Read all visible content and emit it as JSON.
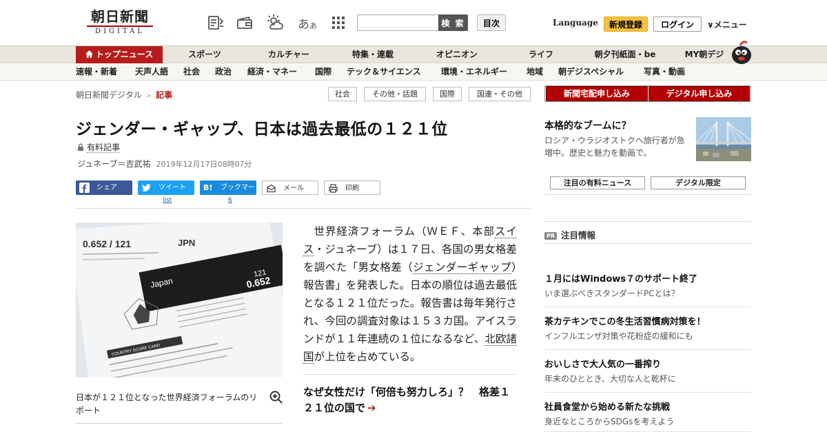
{
  "header": {
    "logo_main": "朝日新聞",
    "logo_sub": "DIGITAL",
    "font_size_main": "あ",
    "font_size_small": "あ",
    "search_placeholder": "",
    "search_button": "検 索",
    "index_button": "目次",
    "language": "Language",
    "register": "新規登録",
    "login": "ログイン",
    "menu": "メニュー",
    "icons": [
      "clip-icon",
      "wallet-icon",
      "weather-icon",
      "font-size-icon",
      "grid-icon"
    ]
  },
  "nav_primary": [
    "トップニュース",
    "スポーツ",
    "カルチャー",
    "特集・連載",
    "オピニオン",
    "ライフ",
    "朝夕刊紙面・be",
    "MY朝デジ"
  ],
  "nav_secondary": [
    "速報・新着",
    "天声人語",
    "社会",
    "政治",
    "経済・マネー",
    "国際",
    "テック＆サイエンス",
    "環境・エネルギー",
    "地域",
    "朝デジスペシャル",
    "写真・動画"
  ],
  "breadcrumb": {
    "home": "朝日新聞デジタル",
    "current": "記事"
  },
  "tags": [
    "社会",
    "その他・話題",
    "国際",
    "国連・その他"
  ],
  "article": {
    "title": "ジェンダー・ギャップ、日本は過去最低の１２１位",
    "paid_label": "有料記事",
    "byline": "ジュネーブ＝吉武祐",
    "date": "2019年12月17日08時07分",
    "body_parts": {
      "p1": "世界経済フォーラム（ＷＥＦ、本部",
      "l1": "スイス",
      "p2": "・ジュネーブ）は１７日、各国の男女格差を調べた「男女格差（",
      "l2": "ジェンダーギャップ",
      "p3": "）報告書」を発表した。日本の順位は過去最低となる１２１位だった。報告書は毎年発行され、今回の調査対象は１５３カ国。アイスランドが１１年連続の１位になるなど、",
      "l3": "北欧諸国",
      "p4": "が上位を占めている。"
    },
    "related": "なぜ女性だけ「何倍も努力しろ」？　格差１２１位の国で",
    "photo_caption": "日本が１２１位となった世界経済フォーラムのリポート",
    "photo_text": {
      "score_line": "0.652 / 121",
      "code": "JPN",
      "country": "Japan",
      "rank": "121",
      "score": "0.652",
      "section": "COUNTRY SCORE CARD"
    }
  },
  "share": {
    "facebook": "シェア",
    "twitter": "ツイート",
    "twitter_count": "list",
    "hatena": "ブックマーク",
    "hatena_badge": "B!",
    "hatena_count": "6",
    "mail": "メール",
    "print": "印刷"
  },
  "sidebar": {
    "promo_paper": "新聞宅配申し込み",
    "promo_digital": "デジタル申し込み",
    "feature_title": "本格的なブームに？",
    "feature_desc": "ロシア・ウラジオストクへ旅行者が急増中。歴史と魅力を動画で。",
    "pick_paid": "注目の有料ニュース",
    "pick_digital": "デジタル限定",
    "pr_badge": "PR",
    "pr_heading": "注目情報",
    "pr_items": [
      {
        "title": "１月にはWindows７のサポート終了",
        "sub": "いま選ぶべきスタンダードPCとは？"
      },
      {
        "title": "茶カテキンでこの冬生活習慣病対策を！",
        "sub": "インフルエンザ対策や花粉症の緩和にも"
      },
      {
        "title": "おいしさで大人気の一番搾り",
        "sub": "年末のひととき、大切な人と乾杯に"
      },
      {
        "title": "社員食堂から始める新たな挑戦",
        "sub": "身近なところからSDGsを考えよう"
      }
    ]
  },
  "colors": {
    "brand_red": "#b71c1c",
    "register_yellow": "#f6c23e",
    "facebook_blue": "#3b5998",
    "twitter_blue": "#1da1f2"
  }
}
